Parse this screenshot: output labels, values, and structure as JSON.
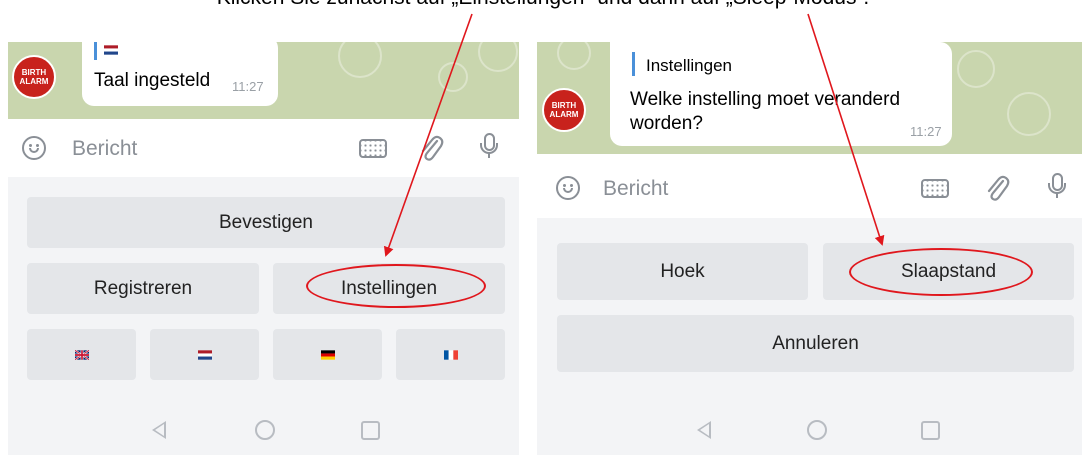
{
  "caption": "Klicken Sie zunächst auf „Einstellungen“ und dann auf „Sleep-Modus“.",
  "left_screen": {
    "avatar_text": "BIRTH ALARM",
    "message": {
      "text": "Taal ingesteld",
      "time": "11:27"
    },
    "input_placeholder": "Bericht",
    "buttons": {
      "confirm": "Bevestigen",
      "register": "Registreren",
      "settings": "Instellingen"
    },
    "flags": [
      "uk-flag",
      "netherlands-flag",
      "germany-flag",
      "france-flag"
    ]
  },
  "right_screen": {
    "avatar_text": "BIRTH ALARM",
    "message": {
      "reply_title": "Instellingen",
      "line1": "Welke instelling moet veranderd",
      "line2": "worden?",
      "time": "11:27"
    },
    "input_placeholder": "Bericht",
    "buttons": {
      "angle": "Hoek",
      "sleep": "Slaapstand",
      "cancel": "Annuleren"
    }
  },
  "colors": {
    "annotation": "#e0171d",
    "chat_background": "#c9d6ae",
    "keyboard_button": "#e4e6e9",
    "avatar": "#c8221c"
  }
}
